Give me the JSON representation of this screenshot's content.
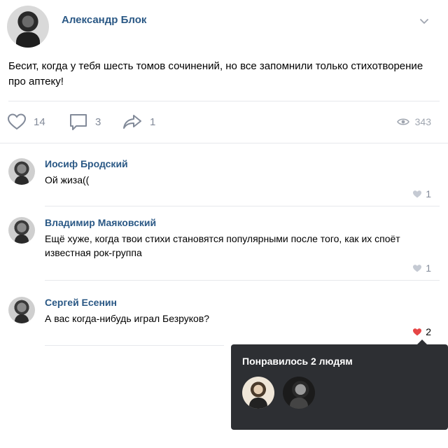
{
  "post": {
    "author": "Александр Блок",
    "text": "Бесит, когда у тебя шесть томов сочинений, но все запомнили только стихотворение про аптеку!",
    "likes": "14",
    "comments": "3",
    "shares": "1",
    "views": "343"
  },
  "comments": [
    {
      "author": "Иосиф Бродский",
      "text": "Ой жиза((",
      "likes": "1",
      "liked": false
    },
    {
      "author": "Владимир Маяковский",
      "text": "Ещё хуже, когда твои стихи становятся популярными после того, как их споёт известная рок-группа",
      "likes": "1",
      "liked": false
    },
    {
      "author": "Сергей Есенин",
      "text": "А вас когда-нибудь играл Безруков?",
      "likes": "2",
      "liked": true
    }
  ],
  "tooltip": {
    "title": "Понравилось 2 людям"
  },
  "colors": {
    "link": "#2a5885",
    "muted": "#828a99",
    "like_active": "#e64646",
    "tooltip_bg": "#2d2f33"
  },
  "icons": [
    "chevron-down-icon",
    "heart-icon",
    "comment-icon",
    "share-icon",
    "eye-icon"
  ]
}
